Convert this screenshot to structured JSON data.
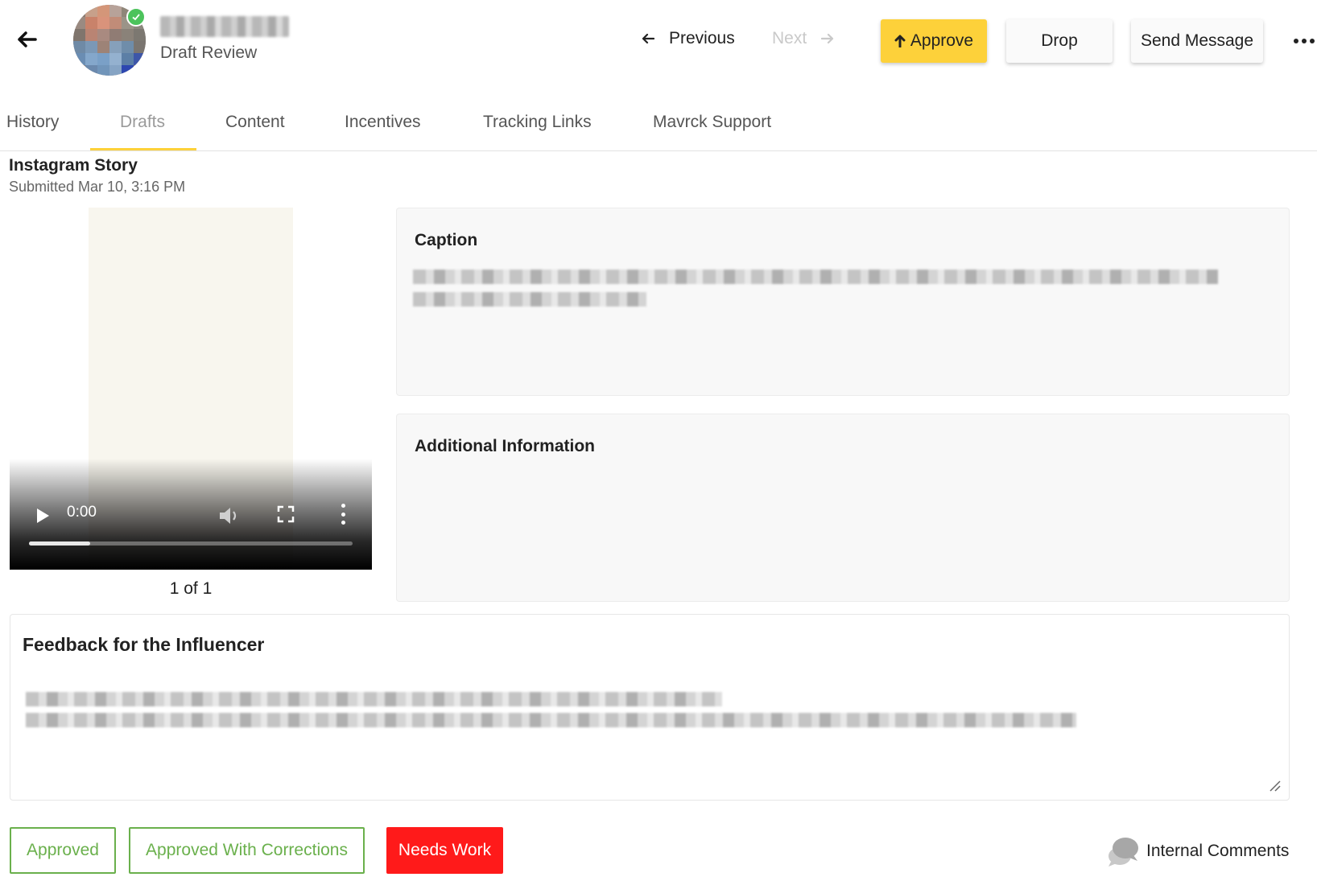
{
  "header": {
    "status": "Draft Review",
    "previous_label": "Previous",
    "next_label": "Next",
    "approve_label": "Approve",
    "drop_label": "Drop",
    "send_message_label": "Send Message"
  },
  "tabs": [
    {
      "label": "History"
    },
    {
      "label": "Drafts"
    },
    {
      "label": "Content"
    },
    {
      "label": "Incentives"
    },
    {
      "label": "Tracking Links"
    },
    {
      "label": "Mavrck Support"
    }
  ],
  "draft": {
    "title": "Instagram Story",
    "submitted": "Submitted Mar 10, 3:16 PM"
  },
  "video": {
    "time": "0:00",
    "progress": 0.19,
    "pager": "1 of 1"
  },
  "caption": {
    "title": "Caption"
  },
  "additional_info": {
    "title": "Additional Information"
  },
  "feedback": {
    "title": "Feedback for the Influencer"
  },
  "actions": {
    "approved_label": "Approved",
    "corrections_label": "Approved With Corrections",
    "needs_work_label": "Needs Work",
    "internal_comments_label": "Internal Comments"
  },
  "colors": {
    "accent": "#fdd13a",
    "approve_green": "#6ab04c",
    "needs_work_red": "#ff1a1a",
    "online_badge": "#4cc35c"
  },
  "icons": {
    "back": "arrow-left-icon",
    "previous": "arrow-left-icon",
    "next": "arrow-right-icon",
    "approve": "arrow-up-icon",
    "more": "ellipsis-icon",
    "internal_comments": "chat-bubbles-icon"
  }
}
